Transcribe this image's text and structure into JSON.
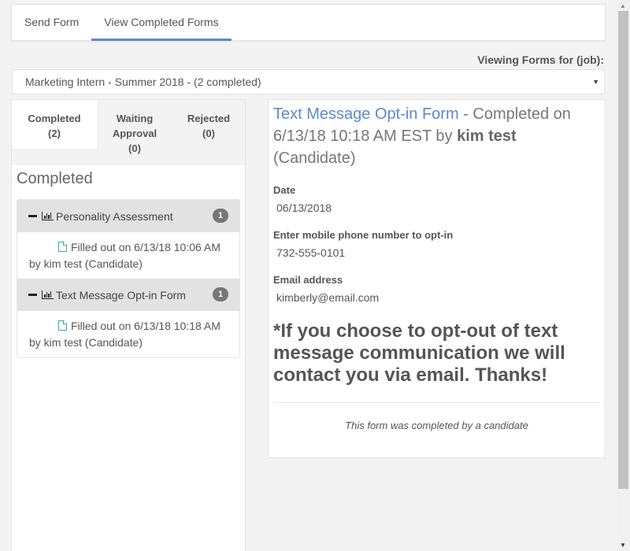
{
  "topnav": {
    "tabs": [
      {
        "label": "Send Form",
        "active": false
      },
      {
        "label": "View Completed Forms",
        "active": true
      }
    ]
  },
  "job_filter": {
    "label": "Viewing Forms for (job):",
    "selected": "Marketing Intern - Summer 2018 - (2 completed)",
    "caret_icon": "triangle-down"
  },
  "status_tabs": [
    {
      "label": "Completed",
      "count": "(2)",
      "active": true
    },
    {
      "label": "Waiting Approval",
      "count": "(0)",
      "active": false
    },
    {
      "label": "Rejected",
      "count": "(0)",
      "active": false
    }
  ],
  "section_title": "Completed",
  "groups": [
    {
      "title": "Personality Assessment",
      "count": "1",
      "entry": {
        "line1": "Filled out on 6/13/18 10:06 AM",
        "line2": "by kim test (Candidate)"
      }
    },
    {
      "title": "Text Message Opt-in Form",
      "count": "1",
      "entry": {
        "line1": "Filled out on 6/13/18 10:18 AM",
        "line2": "by kim test (Candidate)"
      }
    }
  ],
  "detail": {
    "form_name": "Text Message Opt-in Form",
    "completed_prefix": " - Completed on 6/13/18 10:18 AM EST by ",
    "completed_by": "kim test",
    "role": " (Candidate)",
    "fields": [
      {
        "label": "Date",
        "value": "06/13/2018"
      },
      {
        "label": "Enter mobile phone number to opt-in",
        "value": "732-555-0101"
      },
      {
        "label": "Email address",
        "value": "kimberly@email.com"
      }
    ],
    "notice": "*If you choose to opt-out of text message communication we will contact you via email. Thanks!",
    "footer_note": "This form was completed by a candidate"
  },
  "colors": {
    "accent": "#5b8ac9",
    "badge": "#777777",
    "doc_icon": "#3aa8a0",
    "group_header_bg": "#e2e2e2",
    "page_bg": "#f3f3f3"
  }
}
